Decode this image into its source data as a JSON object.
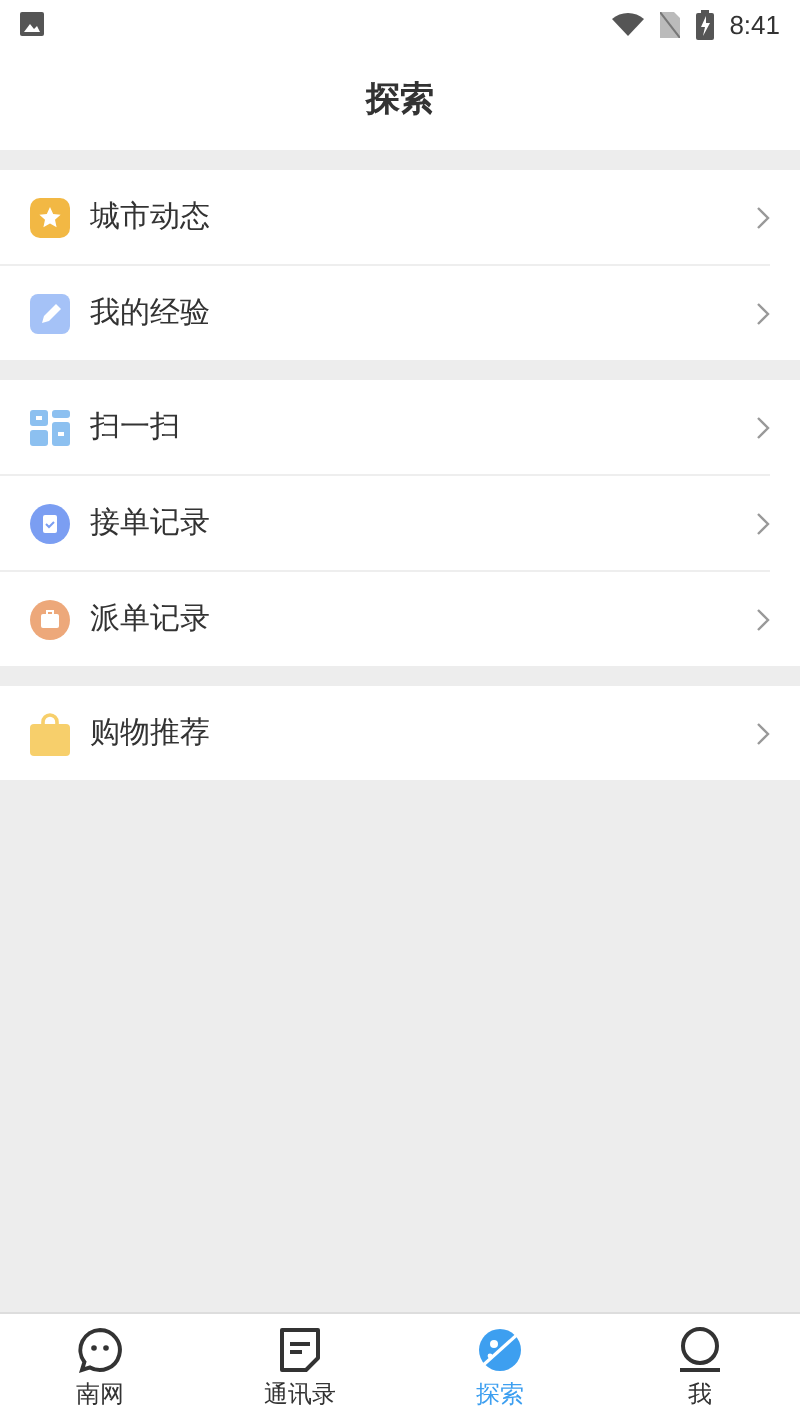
{
  "status_bar": {
    "time": "8:41"
  },
  "header": {
    "title": "探索"
  },
  "groups": [
    {
      "items": [
        {
          "label": "城市动态"
        },
        {
          "label": "我的经验"
        }
      ]
    },
    {
      "items": [
        {
          "label": "扫一扫"
        },
        {
          "label": "接单记录"
        },
        {
          "label": "派单记录"
        }
      ]
    },
    {
      "items": [
        {
          "label": "购物推荐"
        }
      ]
    }
  ],
  "tab_bar": [
    {
      "label": "南网",
      "selected": false
    },
    {
      "label": "通讯录",
      "selected": false
    },
    {
      "label": "探索",
      "selected": true
    },
    {
      "label": "我",
      "selected": false
    }
  ]
}
